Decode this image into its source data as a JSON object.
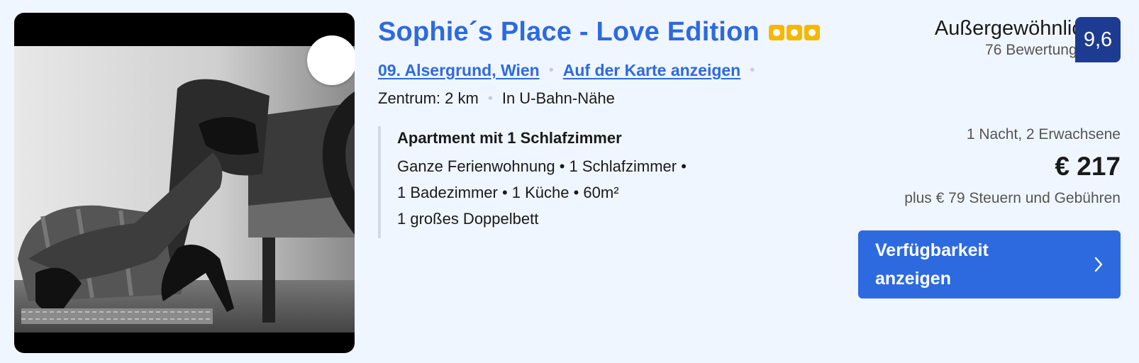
{
  "listing": {
    "title": "Sophie´s Place - Love Edition",
    "stars": 3,
    "district_link": "09. Alsergrund, Wien",
    "map_link": "Auf der Karte anzeigen",
    "distance": "Zentrum: 2 km",
    "transit": "In U-Bahn-Nähe",
    "favorite_icon": "heart-icon"
  },
  "room": {
    "title": "Apartment mit 1 Schlafzimmer",
    "line1": "Ganze Ferienwohnung • 1 Schlafzimmer •",
    "line2": "1 Badezimmer • 1 Küche • 60m²",
    "line3": "1 großes Doppelbett"
  },
  "rating": {
    "label": "Außergewöhnlich",
    "reviews": "76 Bewertungen",
    "score": "9,6"
  },
  "pricing": {
    "stay": "1 Nacht, 2 Erwachsene",
    "price": "€ 217",
    "taxes": "plus € 79 Steuern und Gebühren"
  },
  "cta": {
    "label": "Verfügbarkeit anzeigen",
    "icon": "chevron-right-icon"
  },
  "colors": {
    "accent": "#2d6ae0",
    "score_badge": "#1d3c91",
    "stars": "#f5b800",
    "background": "#f0f6ff"
  }
}
